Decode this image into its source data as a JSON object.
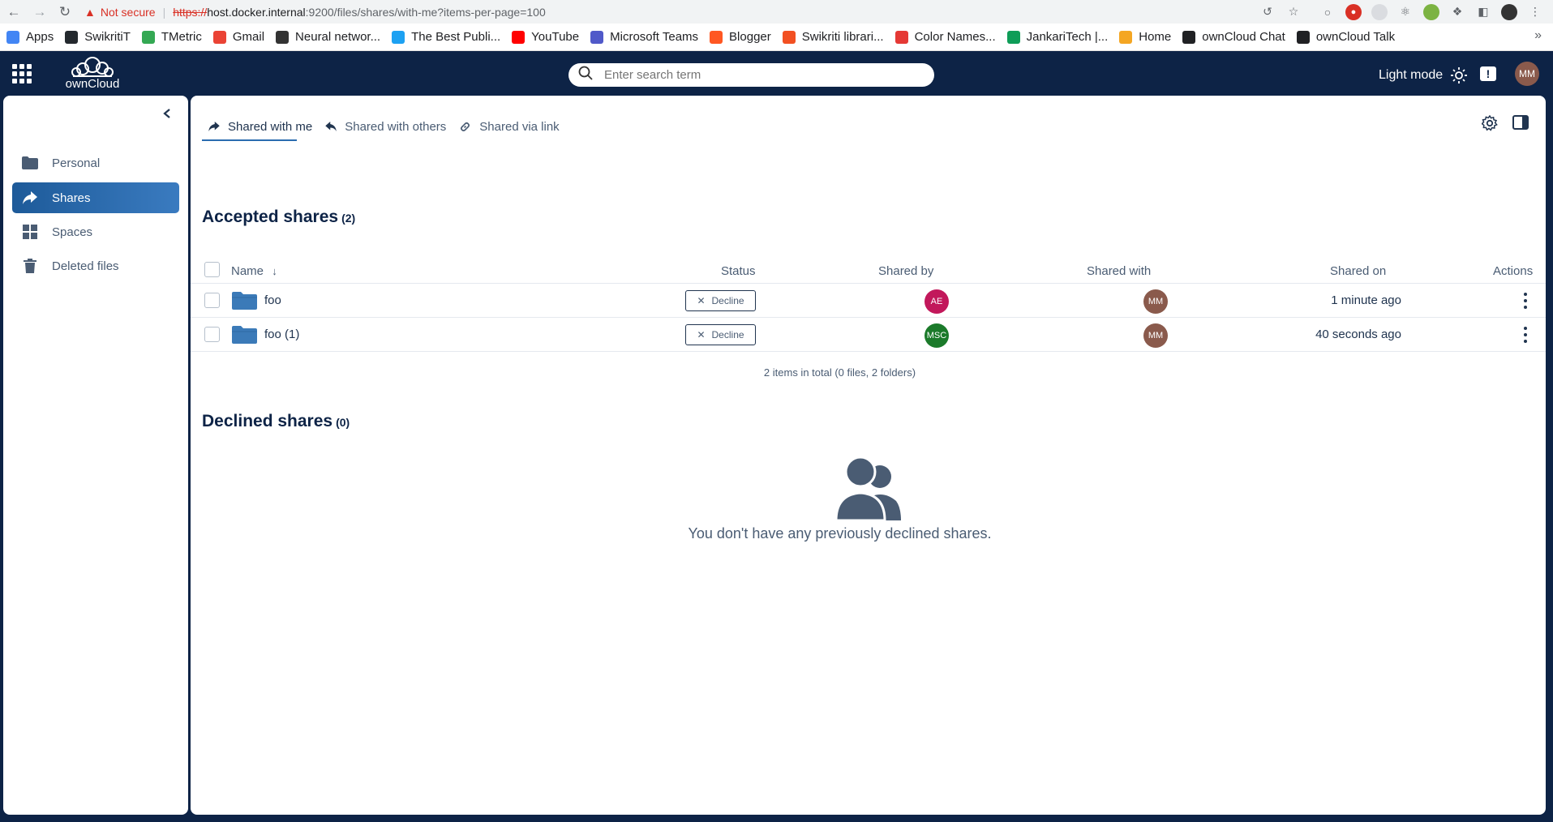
{
  "browser": {
    "not_secure": "Not secure",
    "url_scheme": "https://",
    "url_host": "host.docker.internal",
    "url_rest": ":9200/files/shares/with-me?items-per-page=100"
  },
  "bookmarks": [
    {
      "label": "Apps",
      "color": "#4285f4"
    },
    {
      "label": "SwikritiT",
      "color": "#24292e"
    },
    {
      "label": "TMetric",
      "color": "#34a853"
    },
    {
      "label": "Gmail",
      "color": "#ea4335"
    },
    {
      "label": "Neural networ...",
      "color": "#333333"
    },
    {
      "label": "The Best Publi...",
      "color": "#1da1f2"
    },
    {
      "label": "YouTube",
      "color": "#ff0000"
    },
    {
      "label": "Microsoft Teams",
      "color": "#5059c9"
    },
    {
      "label": "Blogger",
      "color": "#ff5722"
    },
    {
      "label": "Swikriti librari...",
      "color": "#f25022"
    },
    {
      "label": "Color Names...",
      "color": "#e53935"
    },
    {
      "label": "JankariTech |...",
      "color": "#0f9d58"
    },
    {
      "label": "Home",
      "color": "#f4a623"
    },
    {
      "label": "ownCloud Chat",
      "color": "#202124"
    },
    {
      "label": "ownCloud Talk",
      "color": "#202124"
    }
  ],
  "topbar": {
    "logo_text": "ownCloud",
    "search_placeholder": "Enter search term",
    "light_mode": "Light mode",
    "feedback": "!",
    "user_initials": "MM"
  },
  "sidebar": {
    "items": [
      {
        "label": "Personal"
      },
      {
        "label": "Shares"
      },
      {
        "label": "Spaces"
      },
      {
        "label": "Deleted files"
      }
    ]
  },
  "tabs": [
    {
      "label": "Shared with me"
    },
    {
      "label": "Shared with others"
    },
    {
      "label": "Shared via link"
    }
  ],
  "accepted": {
    "title": "Accepted shares",
    "count": "(2)",
    "columns": {
      "name": "Name",
      "status": "Status",
      "shared_by": "Shared by",
      "shared_with": "Shared with",
      "shared_on": "Shared on",
      "actions": "Actions"
    },
    "rows": [
      {
        "name": "foo",
        "status": "Decline",
        "shared_by": "AE",
        "shared_by_color": "#c2185b",
        "shared_with": "MM",
        "shared_with_color": "#8a5a4c",
        "shared_on": "1 minute ago"
      },
      {
        "name": "foo (1)",
        "status": "Decline",
        "shared_by": "MSC",
        "shared_by_color": "#1b7a2a",
        "shared_with": "MM",
        "shared_with_color": "#8a5a4c",
        "shared_on": "40 seconds ago"
      }
    ],
    "total": "2 items in total (0 files, 2 folders)"
  },
  "declined": {
    "title": "Declined shares",
    "count": "(0)",
    "empty_message": "You don't have any previously declined shares."
  }
}
